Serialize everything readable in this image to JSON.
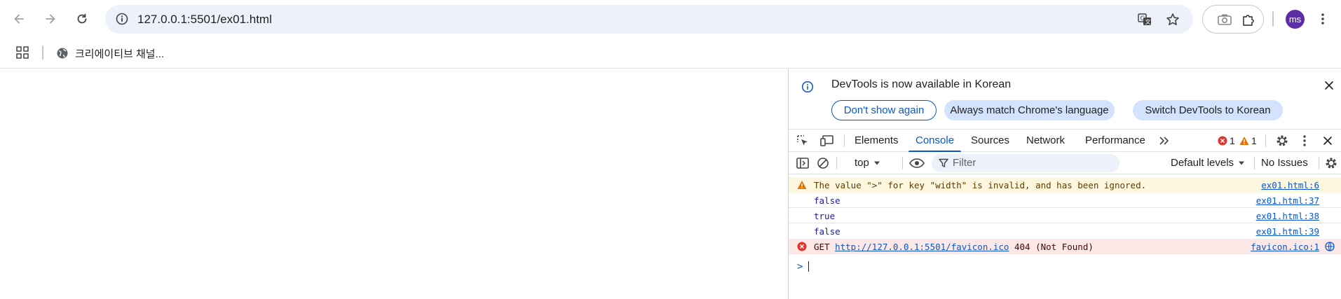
{
  "browser": {
    "url_host": "127.0.0.1",
    "url_rest": ":5501/ex01.html",
    "avatar_initials": "ms",
    "icons": [
      "back-icon",
      "forward-icon",
      "reload-icon",
      "site-info-icon",
      "translate-icon",
      "bookmark-star-icon",
      "screenshot-icon",
      "extensions-icon",
      "menu-icon"
    ]
  },
  "bookmarks": {
    "items": [
      {
        "label": "크리에이티브 채널..."
      }
    ]
  },
  "devtools": {
    "infobar": {
      "message": "DevTools is now available in Korean",
      "dont_show": "Don't show again",
      "always_match": "Always match Chrome's language",
      "switch_korean": "Switch DevTools to Korean"
    },
    "tabs": [
      {
        "label": "Elements"
      },
      {
        "label": "Console"
      },
      {
        "label": "Sources"
      },
      {
        "label": "Network"
      },
      {
        "label": "Performance"
      }
    ],
    "active_tab": "Console",
    "error_count": "1",
    "warning_count": "1",
    "toolbar": {
      "context": "top",
      "filter_placeholder": "Filter",
      "levels": "Default levels",
      "issues": "No Issues"
    },
    "console": {
      "warning": {
        "text": "The value \">\" for key \"width\" is invalid, and has been ignored.",
        "source": "ex01.html:6"
      },
      "logs": [
        {
          "text": "false",
          "source": "ex01.html:37"
        },
        {
          "text": "true",
          "source": "ex01.html:38"
        },
        {
          "text": "false",
          "source": "ex01.html:39"
        }
      ],
      "error": {
        "method": "GET",
        "url": "http://127.0.0.1:5501/favicon.ico",
        "status": "404 (Not Found)",
        "source": "favicon.ico:1"
      },
      "prompt": ">"
    },
    "colors": {
      "accent": "#0b57d0",
      "error": "#dc362e",
      "warning": "#e37400"
    }
  }
}
